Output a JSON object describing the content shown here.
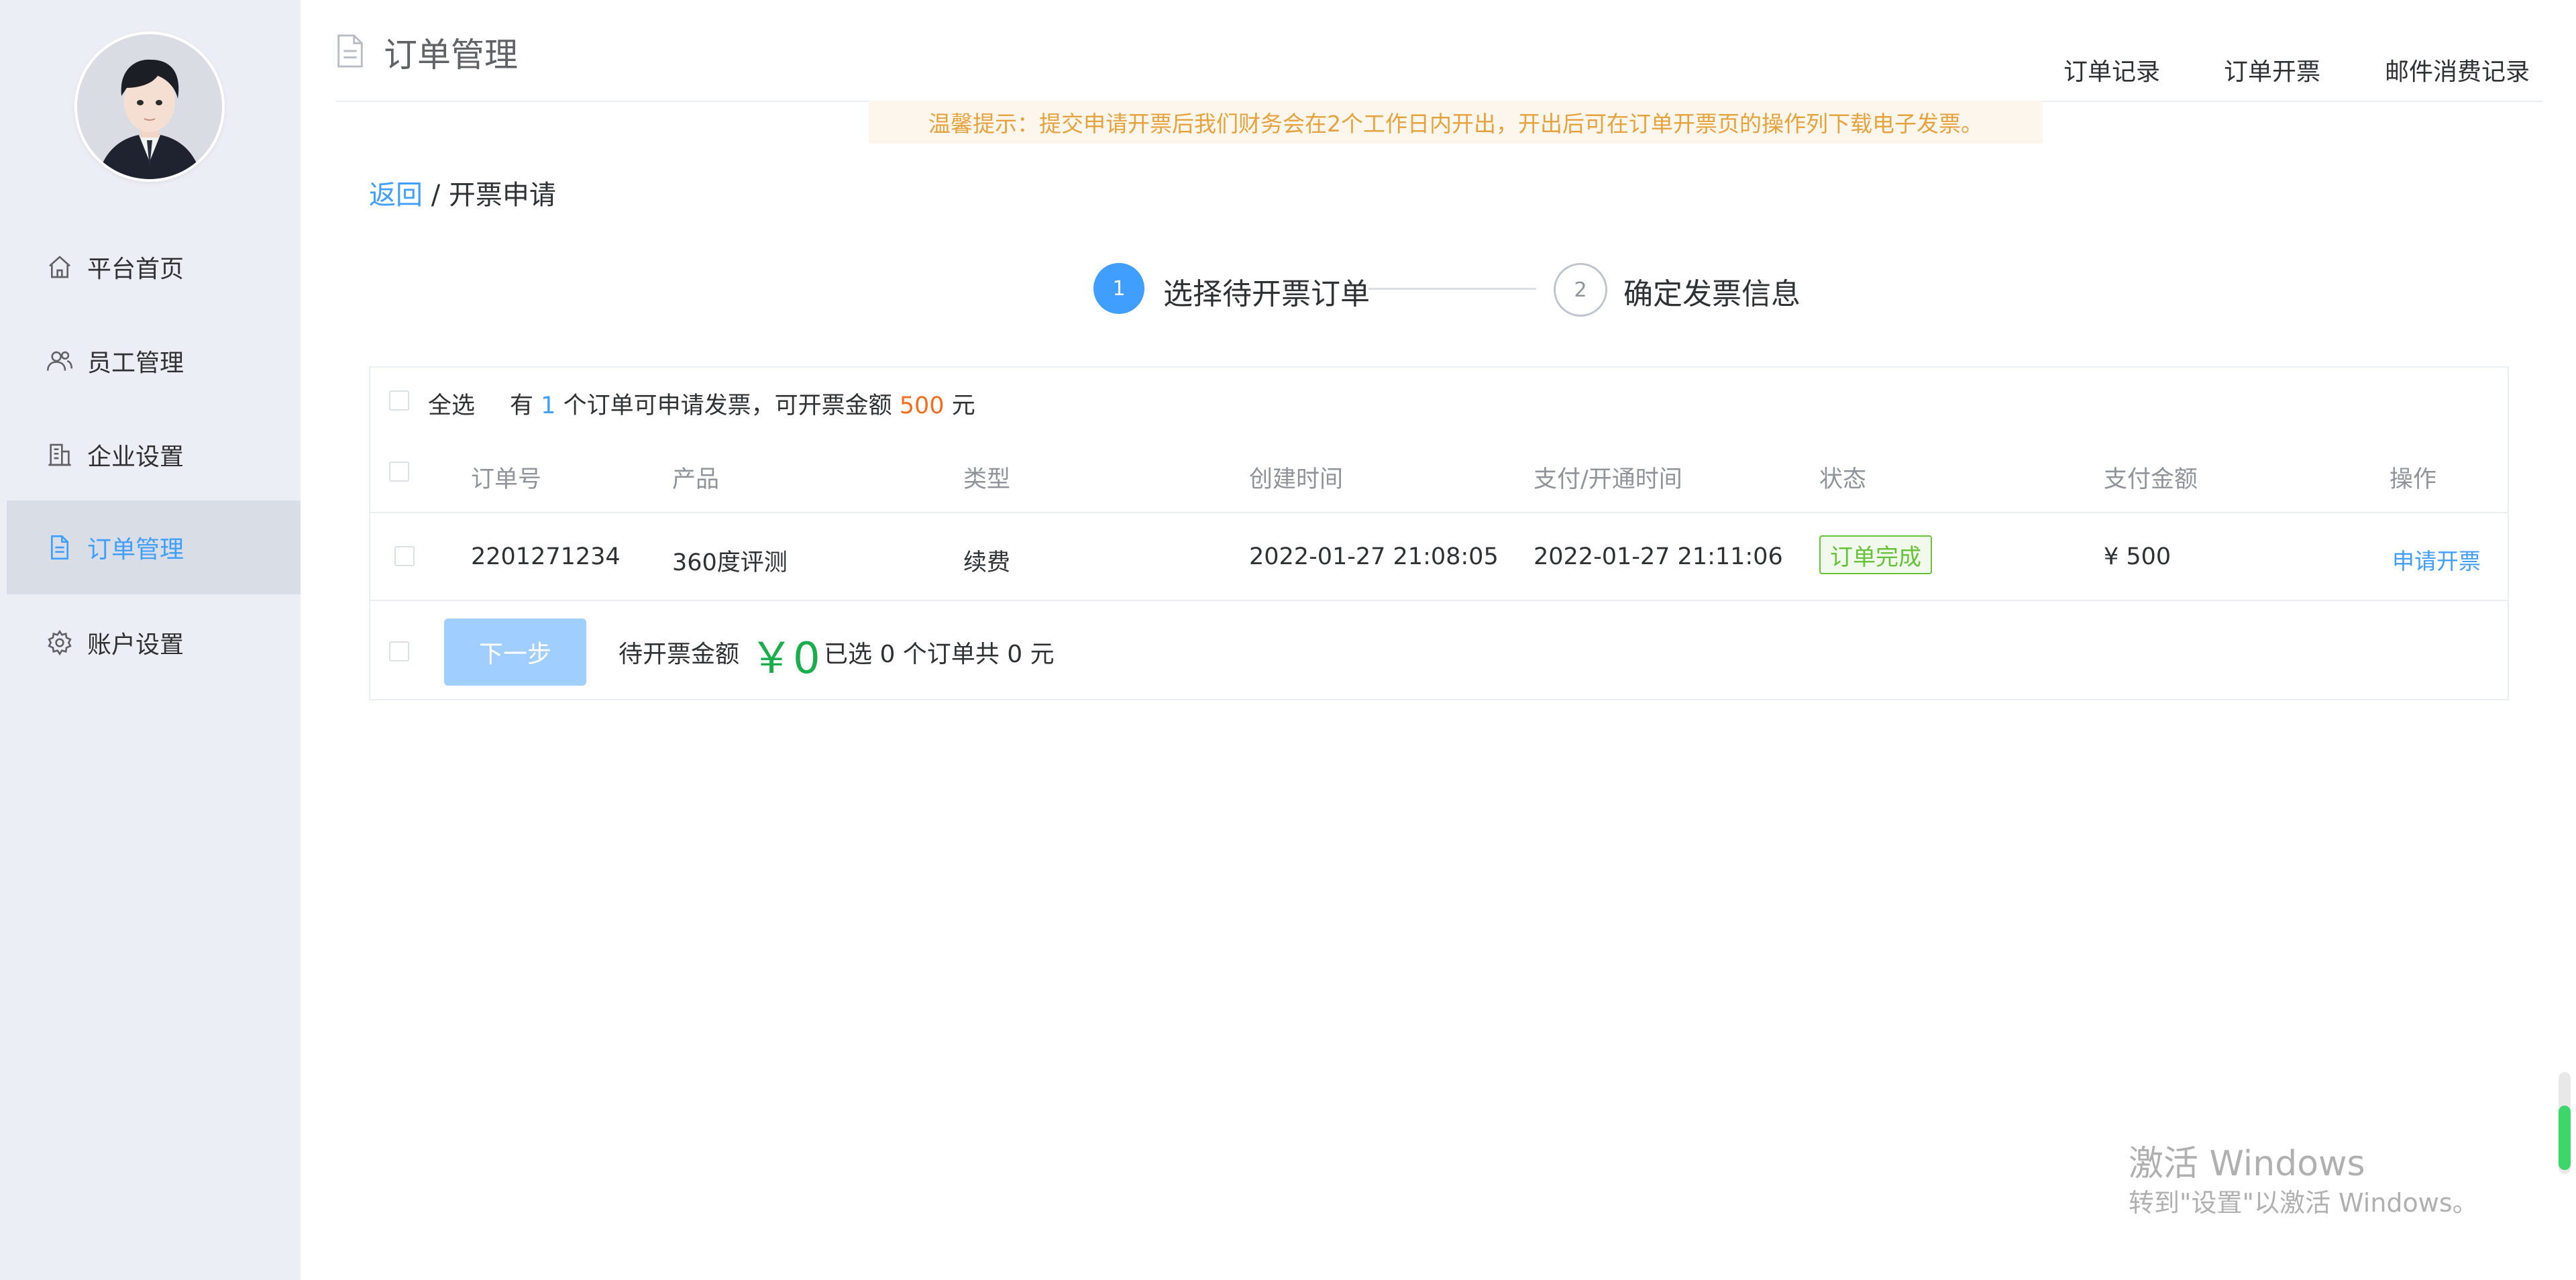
{
  "sidebar": {
    "items": [
      {
        "label": "平台首页",
        "icon": "home-icon",
        "active": false
      },
      {
        "label": "员工管理",
        "icon": "users-icon",
        "active": false
      },
      {
        "label": "企业设置",
        "icon": "building-icon",
        "active": false
      },
      {
        "label": "订单管理",
        "icon": "document-icon",
        "active": true
      },
      {
        "label": "账户设置",
        "icon": "gear-icon",
        "active": false
      }
    ]
  },
  "header": {
    "title": "订单管理",
    "links": [
      "订单记录",
      "订单开票",
      "邮件消费记录"
    ]
  },
  "notice": "温馨提示：提交申请开票后我们财务会在2个工作日内开出，开出后可在订单开票页的操作列下载电子发票。",
  "breadcrumb": {
    "back": "返回",
    "separator": "/",
    "current": "开票申请"
  },
  "steps": [
    {
      "number": "1",
      "label": "选择待开票订单",
      "active": true
    },
    {
      "number": "2",
      "label": "确定发票信息",
      "active": false
    }
  ],
  "summary": {
    "select_all": "全选",
    "prefix": "有",
    "count": "1",
    "middle": "个订单可申请发票，可开票金额",
    "amount": "500",
    "suffix": "元"
  },
  "table": {
    "columns": [
      "订单号",
      "产品",
      "类型",
      "创建时间",
      "支付/开通时间",
      "状态",
      "支付金额",
      "操作"
    ],
    "rows": [
      {
        "order_no": "2201271234",
        "product": "360度评测",
        "type": "续费",
        "created": "2022-01-27 21:08:05",
        "paid": "2022-01-27 21:11:06",
        "status": "订单完成",
        "amount": "¥ 500",
        "action": "申请开票"
      }
    ]
  },
  "footer": {
    "next_button": "下一步",
    "pending_label": "待开票金额",
    "pending_amount": "￥0",
    "selected_text": "已选 0 个订单共 0 元"
  },
  "watermark": {
    "line1": "激活 Windows",
    "line2": "转到\"设置\"以激活 Windows。"
  },
  "colors": {
    "accent": "#409eff",
    "success": "#67c23a",
    "amount_green": "#1aad4b",
    "orange": "#f56c1f",
    "notice_bg": "#fdf6ec",
    "notice_text": "#e6a23c"
  }
}
